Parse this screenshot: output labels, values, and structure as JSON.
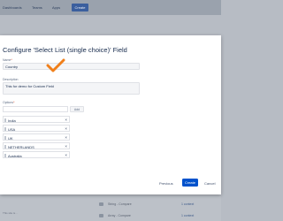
{
  "topbar": {
    "dashboards": "Dashboards",
    "teams": "Teams",
    "apps": "Apps",
    "create": "Create"
  },
  "dialog": {
    "title": "Configure 'Select List (single choice)' Field",
    "name_label": "Name",
    "name_value": "Country",
    "description_label": "Description",
    "description_value": "This for demo for Custom Field",
    "options_label": "Options",
    "add_button": "Add",
    "options": [
      "India",
      "USA",
      "UK",
      "NETHERLANDS",
      "Australia"
    ],
    "remove_symbol": "×",
    "required_marker": "*",
    "previous": "Previous",
    "create": "Create",
    "cancel": "Cancel"
  },
  "background_rows": [
    {
      "name": "String - Compare",
      "link": "1 context"
    },
    {
      "name": "Array - Compare",
      "link": "1 context"
    }
  ],
  "footer": "This site is..."
}
